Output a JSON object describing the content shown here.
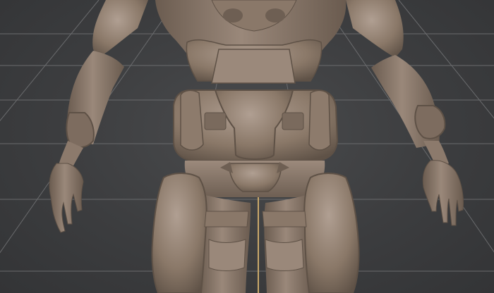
{
  "app": {
    "kind": "3d-viewport",
    "background_color": "#3c3d3f",
    "grid_color": "#6a6b6d",
    "axis_color": "#c9a86a",
    "model_color": "#8a7766",
    "model_highlight": "#a8978a",
    "model_shadow": "#5d5046"
  }
}
